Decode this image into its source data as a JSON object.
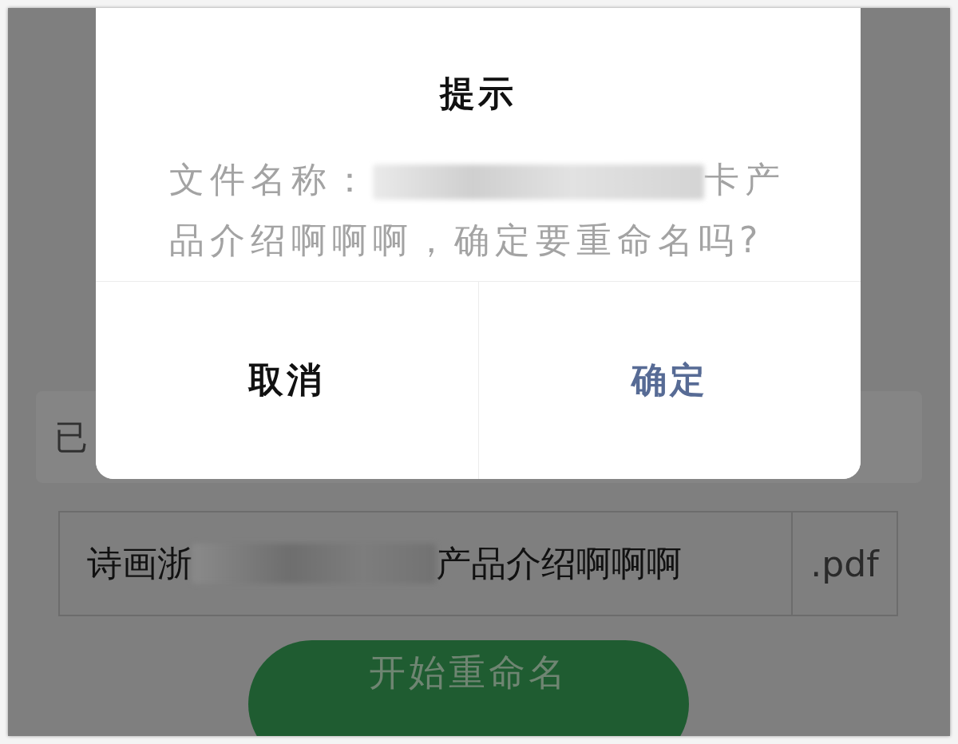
{
  "dialog": {
    "title": "提示",
    "message": {
      "before": "文件名称：",
      "after": "卡产品介绍啊啊啊，确定要重命名吗?"
    },
    "buttons": [
      {
        "label": "取消",
        "kind": "cancel"
      },
      {
        "label": "确定",
        "kind": "confirm"
      }
    ]
  },
  "selected_card": {
    "label": "已"
  },
  "name_field": {
    "value_start": "诗画浙",
    "value_end": "产品介绍啊啊啊",
    "extension": ".pdf"
  },
  "rename_button": {
    "label": "开始重命名"
  }
}
